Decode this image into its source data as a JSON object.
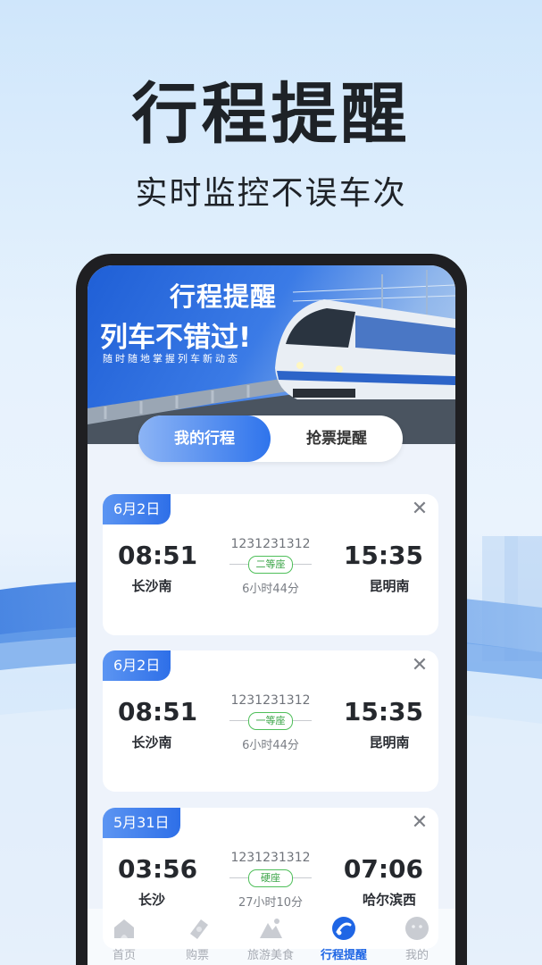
{
  "headline": "行程提醒",
  "subline": "实时监控不误车次",
  "banner": {
    "title": "行程提醒",
    "slogan": "列车不错过!",
    "desc": "随时随地掌握列车新动态"
  },
  "tabs": [
    {
      "label": "我的行程",
      "active": true
    },
    {
      "label": "抢票提醒",
      "active": false
    }
  ],
  "trips": [
    {
      "date": "6月2日",
      "dep_time": "08:51",
      "dep_station": "长沙南",
      "arr_time": "15:35",
      "arr_station": "昆明南",
      "train_no": "1231231312",
      "seat": "二等座",
      "duration": "6小时44分"
    },
    {
      "date": "6月2日",
      "dep_time": "08:51",
      "dep_station": "长沙南",
      "arr_time": "15:35",
      "arr_station": "昆明南",
      "train_no": "1231231312",
      "seat": "一等座",
      "duration": "6小时44分"
    },
    {
      "date": "5月31日",
      "dep_time": "03:56",
      "dep_station": "长沙",
      "arr_time": "07:06",
      "arr_station": "哈尔滨西",
      "train_no": "1231231312",
      "seat": "硬座",
      "duration": "27小时10分"
    }
  ],
  "close_glyph": "✕",
  "tabbar": [
    {
      "label": "首页",
      "icon": "home-icon",
      "active": false
    },
    {
      "label": "购票",
      "icon": "ticket-icon",
      "active": false
    },
    {
      "label": "旅游美食",
      "icon": "mountain-icon",
      "active": false
    },
    {
      "label": "行程提醒",
      "icon": "trip-reminder-icon",
      "active": true
    },
    {
      "label": "我的",
      "icon": "profile-icon",
      "active": false
    }
  ],
  "colors": {
    "accent": "#2f74ec",
    "seat_green": "#3aa447",
    "active_tab": "#1f66e5"
  }
}
